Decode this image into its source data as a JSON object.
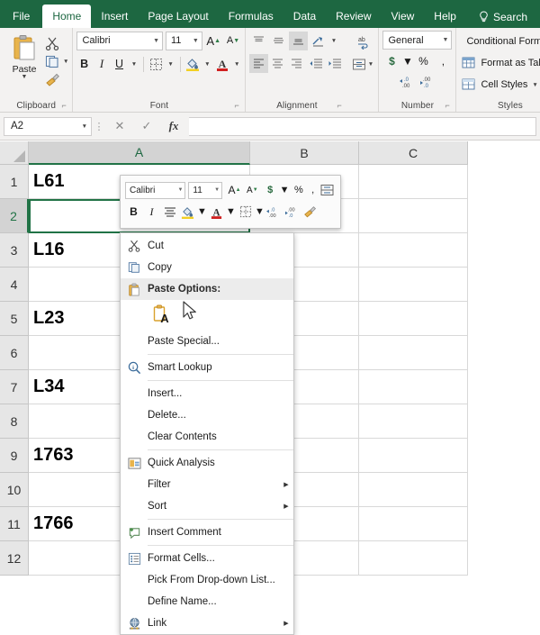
{
  "ribbon": {
    "tabs": [
      {
        "label": "File",
        "active": false
      },
      {
        "label": "Home",
        "active": true
      },
      {
        "label": "Insert",
        "active": false
      },
      {
        "label": "Page Layout",
        "active": false
      },
      {
        "label": "Formulas",
        "active": false
      },
      {
        "label": "Data",
        "active": false
      },
      {
        "label": "Review",
        "active": false
      },
      {
        "label": "View",
        "active": false
      },
      {
        "label": "Help",
        "active": false
      }
    ],
    "search_label": "Search",
    "groups": {
      "clipboard": {
        "label": "Clipboard",
        "paste_label": "Paste",
        "cut_icon": "scissors-icon",
        "copy_icon": "copy-icon",
        "format_painter_icon": "format-painter-icon"
      },
      "font": {
        "label": "Font",
        "font_name": "Calibri",
        "font_size": "11",
        "grow_font": "A",
        "shrink_font": "A",
        "bold": "B",
        "italic": "I",
        "underline": "U"
      },
      "alignment": {
        "label": "Alignment"
      },
      "number": {
        "label": "Number",
        "format": "General",
        "currency": "$",
        "percent": "%",
        "comma": ",",
        "decrease_decimal": ".00",
        "increase_decimal": ".00"
      },
      "styles": {
        "label": "Styles",
        "items": [
          "Conditional Formatting",
          "Format as Table",
          "Cell Styles"
        ]
      }
    }
  },
  "formula_bar": {
    "name_box": "A2",
    "cancel_icon": "close-icon",
    "confirm_icon": "check-icon",
    "function_icon": "fx-icon",
    "formula_value": ""
  },
  "grid": {
    "columns": [
      "A",
      "B",
      "C"
    ],
    "selected_column": "A",
    "rows": [
      "1",
      "2",
      "3",
      "4",
      "5",
      "6",
      "7",
      "8",
      "9",
      "10",
      "11",
      "12"
    ],
    "selected_row": "2",
    "selected_cell": "A2",
    "cells": [
      {
        "row": "1",
        "a": "L61"
      },
      {
        "row": "2",
        "a": ""
      },
      {
        "row": "3",
        "a": "L16"
      },
      {
        "row": "4",
        "a": ""
      },
      {
        "row": "5",
        "a": "L23"
      },
      {
        "row": "6",
        "a": ""
      },
      {
        "row": "7",
        "a": "L34"
      },
      {
        "row": "8",
        "a": ""
      },
      {
        "row": "9",
        "a": "1763"
      },
      {
        "row": "10",
        "a": ""
      },
      {
        "row": "11",
        "a": "1766"
      },
      {
        "row": "12",
        "a": ""
      }
    ]
  },
  "mini_toolbar": {
    "font_name": "Calibri",
    "font_size": "11",
    "grow_font": "A",
    "shrink_font": "A",
    "currency": "$",
    "percent": "%",
    "comma": ",",
    "bold": "B",
    "italic": "I"
  },
  "context_menu": {
    "items": [
      {
        "label": "Cut",
        "icon": "scissors-icon",
        "type": "item",
        "arrow": false
      },
      {
        "label": "Copy",
        "icon": "copy-icon",
        "type": "item",
        "arrow": false
      },
      {
        "label": "Paste Options:",
        "icon": "paste-icon",
        "type": "header",
        "arrow": false
      },
      {
        "label": "Paste Special...",
        "icon": "",
        "type": "item",
        "arrow": false
      },
      {
        "label": "Smart Lookup",
        "icon": "smart-lookup-icon",
        "type": "item",
        "arrow": false
      },
      {
        "label": "Insert...",
        "icon": "",
        "type": "item",
        "arrow": false
      },
      {
        "label": "Delete...",
        "icon": "",
        "type": "item",
        "arrow": false
      },
      {
        "label": "Clear Contents",
        "icon": "",
        "type": "item",
        "arrow": false
      },
      {
        "label": "Quick Analysis",
        "icon": "quick-analysis-icon",
        "type": "item",
        "arrow": false
      },
      {
        "label": "Filter",
        "icon": "",
        "type": "item",
        "arrow": true
      },
      {
        "label": "Sort",
        "icon": "",
        "type": "item",
        "arrow": true
      },
      {
        "label": "Insert Comment",
        "icon": "comment-icon",
        "type": "item",
        "arrow": false
      },
      {
        "label": "Format Cells...",
        "icon": "format-cells-icon",
        "type": "item",
        "arrow": false
      },
      {
        "label": "Pick From Drop-down List...",
        "icon": "",
        "type": "item",
        "arrow": false
      },
      {
        "label": "Define Name...",
        "icon": "",
        "type": "item",
        "arrow": false
      },
      {
        "label": "Link",
        "icon": "link-icon",
        "type": "item",
        "arrow": true
      }
    ],
    "paste_option_icon": "paste-values-icon"
  },
  "colors": {
    "accent_green": "#1D6741",
    "selection_green": "#217346",
    "ribbon_bg": "#f3f2f1",
    "header_bg": "#e6e6e6"
  }
}
